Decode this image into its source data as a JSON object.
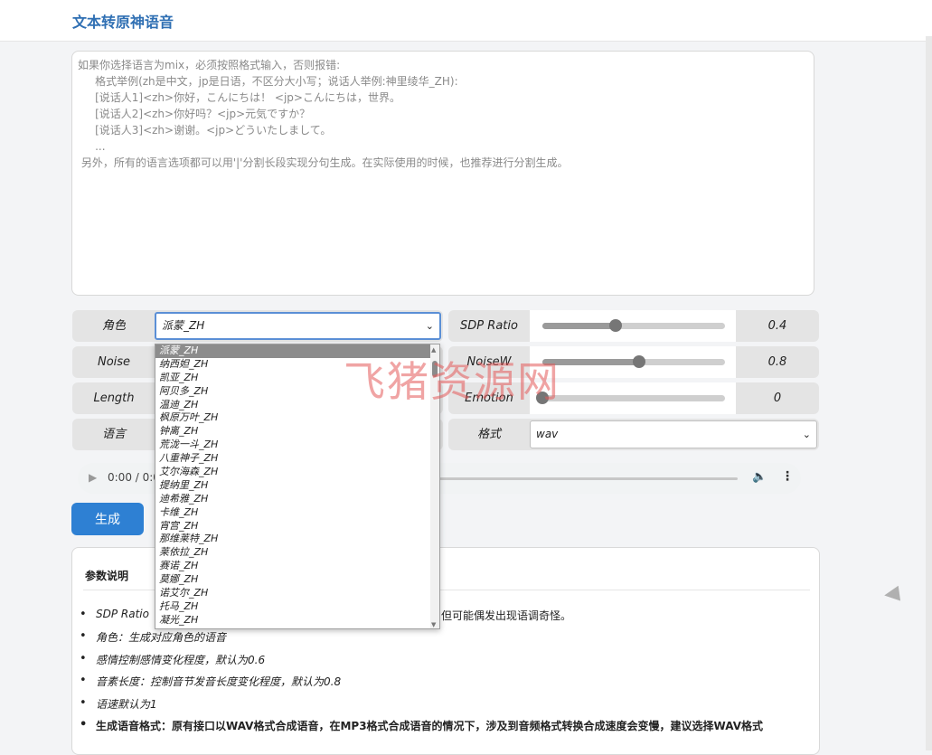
{
  "app": {
    "title": "文本转原神语音"
  },
  "text_input": {
    "value": "如果你选择语言为mix，必须按照格式输入，否则报错:\n     格式举例(zh是中文，jp是日语，不区分大小写；说话人举例:神里绫华_ZH):\n     [说话人1]<zh>你好，こんにちは！ <jp>こんにちは，世界。\n     [说话人2]<zh>你好吗？<jp>元気ですか？\n     [说话人3]<zh>谢谢。<jp>どういたしまして。\n     ...\n 另外，所有的语言选项都可以用'|'分割长段实现分句生成。在实际使用的时候，也推荐进行分割生成。"
  },
  "controls": {
    "speaker": {
      "label": "角色",
      "value": "派蒙_ZH",
      "chevron": "⌄"
    },
    "noise": {
      "label": "Noise"
    },
    "length": {
      "label": "Length"
    },
    "language": {
      "label": "语言"
    },
    "sdp_ratio": {
      "label": "SDP Ratio",
      "value": "0.4",
      "fraction": 0.4
    },
    "noisew": {
      "label": "NoiseW",
      "value": "0.8",
      "fraction": 0.53
    },
    "emotion": {
      "label": "Emotion",
      "value": "0",
      "fraction": 0.0
    },
    "format": {
      "label": "格式",
      "value": "wav",
      "chevron": "⌄"
    }
  },
  "speaker_options": [
    "派蒙_ZH",
    "纳西妲_ZH",
    "凯亚_ZH",
    "阿贝多_ZH",
    "温迪_ZH",
    "枫原万叶_ZH",
    "钟离_ZH",
    "荒泷一斗_ZH",
    "八重神子_ZH",
    "艾尔海森_ZH",
    "提纳里_ZH",
    "迪希雅_ZH",
    "卡维_ZH",
    "宵宫_ZH",
    "那维莱特_ZH",
    "莱依拉_ZH",
    "赛诺_ZH",
    "莫娜_ZH",
    "诺艾尔_ZH",
    "托马_ZH",
    "凝光_ZH"
  ],
  "audio": {
    "time": "0:00 / 0:0",
    "play_icon": "▶",
    "volume_icon": "🔈",
    "more_icon": "⋮"
  },
  "generate_button": "生成",
  "params": {
    "title": "参数说明",
    "items": [
      "SDP Ratio",
      "但可能偶发出现语调奇怪。",
      "角色：生成对应角色的语音",
      "感情控制感情变化程度，默认为0.6",
      "音素长度：控制音节发音长度变化程度，默认为0.8",
      "语速默认为1",
      "生成语音格式：原有接口以WAV格式合成语音，在MP3格式合成语音的情况下，涉及到音频格式转换合成速度会变慢，建议选择WAV格式"
    ]
  },
  "watermark": "飞猪资源网"
}
